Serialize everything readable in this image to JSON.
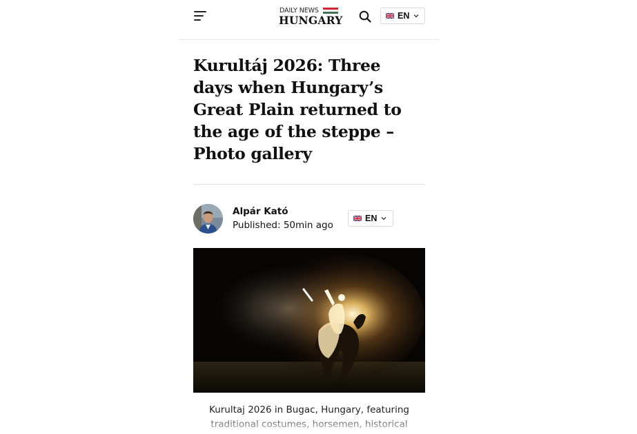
{
  "header": {
    "logo_small": "DAILY NEWS",
    "logo_big": "HUNGARY",
    "language": "EN"
  },
  "icons": {
    "menu": "hamburger-menu-icon",
    "search": "search-icon",
    "flag": "uk-flag-icon",
    "dropdown": "chevron-down-icon"
  },
  "article": {
    "title": "Kurultáj 2026: Three days when Hungary’s Great Plain returned to the age of the steppe – Photo gallery",
    "author": "Alpár Kató",
    "published": "Published: 50min ago",
    "language": "EN",
    "caption": "Kurultaj 2026 in Bugac, Hungary, featuring traditional costumes, horsemen, historical"
  },
  "colors": {
    "flag_red": "#ce2939",
    "flag_white": "#ffffff",
    "flag_green": "#477050",
    "text": "#111111",
    "divider": "#e2e2e2"
  }
}
